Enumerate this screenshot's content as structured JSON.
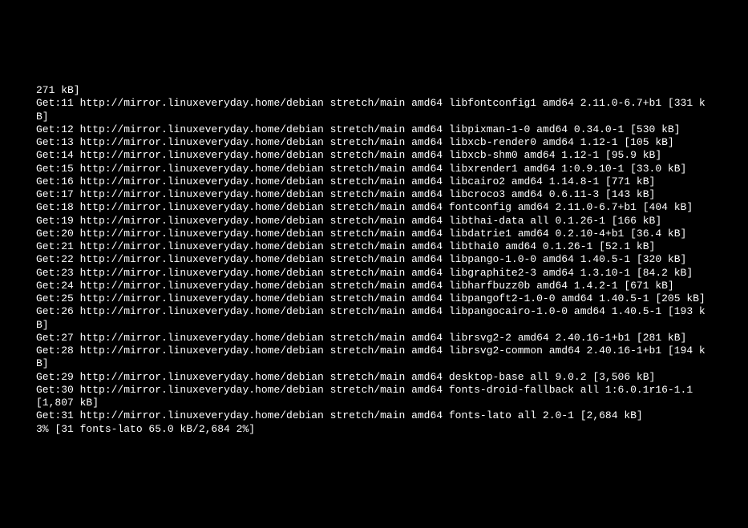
{
  "terminal": {
    "lines": [
      "271 kB]",
      "Get:11 http://mirror.linuxeveryday.home/debian stretch/main amd64 libfontconfig1 amd64 2.11.0-6.7+b1 [331 kB]",
      "Get:12 http://mirror.linuxeveryday.home/debian stretch/main amd64 libpixman-1-0 amd64 0.34.0-1 [530 kB]",
      "Get:13 http://mirror.linuxeveryday.home/debian stretch/main amd64 libxcb-render0 amd64 1.12-1 [105 kB]",
      "Get:14 http://mirror.linuxeveryday.home/debian stretch/main amd64 libxcb-shm0 amd64 1.12-1 [95.9 kB]",
      "Get:15 http://mirror.linuxeveryday.home/debian stretch/main amd64 libxrender1 amd64 1:0.9.10-1 [33.0 kB]",
      "Get:16 http://mirror.linuxeveryday.home/debian stretch/main amd64 libcairo2 amd64 1.14.8-1 [771 kB]",
      "Get:17 http://mirror.linuxeveryday.home/debian stretch/main amd64 libcroco3 amd64 0.6.11-3 [143 kB]",
      "Get:18 http://mirror.linuxeveryday.home/debian stretch/main amd64 fontconfig amd64 2.11.0-6.7+b1 [404 kB]",
      "Get:19 http://mirror.linuxeveryday.home/debian stretch/main amd64 libthai-data all 0.1.26-1 [166 kB]",
      "Get:20 http://mirror.linuxeveryday.home/debian stretch/main amd64 libdatrie1 amd64 0.2.10-4+b1 [36.4 kB]",
      "Get:21 http://mirror.linuxeveryday.home/debian stretch/main amd64 libthai0 amd64 0.1.26-1 [52.1 kB]",
      "Get:22 http://mirror.linuxeveryday.home/debian stretch/main amd64 libpango-1.0-0 amd64 1.40.5-1 [320 kB]",
      "Get:23 http://mirror.linuxeveryday.home/debian stretch/main amd64 libgraphite2-3 amd64 1.3.10-1 [84.2 kB]",
      "Get:24 http://mirror.linuxeveryday.home/debian stretch/main amd64 libharfbuzz0b amd64 1.4.2-1 [671 kB]",
      "Get:25 http://mirror.linuxeveryday.home/debian stretch/main amd64 libpangoft2-1.0-0 amd64 1.40.5-1 [205 kB]",
      "Get:26 http://mirror.linuxeveryday.home/debian stretch/main amd64 libpangocairo-1.0-0 amd64 1.40.5-1 [193 kB]",
      "Get:27 http://mirror.linuxeveryday.home/debian stretch/main amd64 librsvg2-2 amd64 2.40.16-1+b1 [281 kB]",
      "Get:28 http://mirror.linuxeveryday.home/debian stretch/main amd64 librsvg2-common amd64 2.40.16-1+b1 [194 kB]",
      "Get:29 http://mirror.linuxeveryday.home/debian stretch/main amd64 desktop-base all 9.0.2 [3,506 kB]",
      "Get:30 http://mirror.linuxeveryday.home/debian stretch/main amd64 fonts-droid-fallback all 1:6.0.1r16-1.1 [1,807 kB]",
      "Get:31 http://mirror.linuxeveryday.home/debian stretch/main amd64 fonts-lato all 2.0-1 [2,684 kB]",
      "3% [31 fonts-lato 65.0 kB/2,684 2%]"
    ]
  }
}
